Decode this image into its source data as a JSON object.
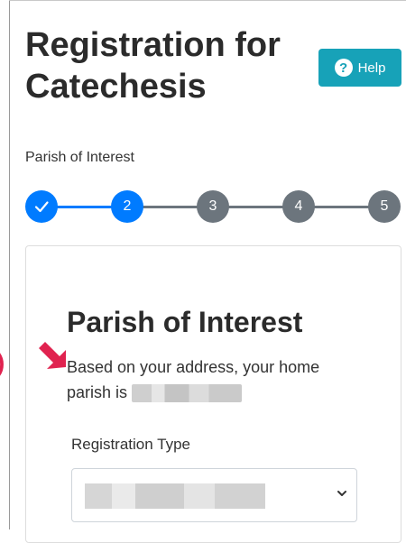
{
  "header": {
    "title": "Registration for Catechesis",
    "help_label": "Help",
    "help_icon": "question-circle-icon"
  },
  "step_label": "Parish of Interest",
  "stepper": {
    "current_step": 2,
    "steps": [
      {
        "label": "",
        "state": "complete"
      },
      {
        "label": "2",
        "state": "active"
      },
      {
        "label": "3",
        "state": "upcoming"
      },
      {
        "label": "4",
        "state": "upcoming"
      },
      {
        "label": "5",
        "state": "upcoming"
      }
    ]
  },
  "card": {
    "heading": "Parish of Interest",
    "description": "Based on your address, your home parish is",
    "registration_type_label": "Registration Type"
  },
  "annotation": {
    "paren": ")"
  },
  "colors": {
    "primary": "#007bff",
    "info": "#17a2b8",
    "step_inactive": "#6c757d",
    "annotation": "#e0224f"
  }
}
